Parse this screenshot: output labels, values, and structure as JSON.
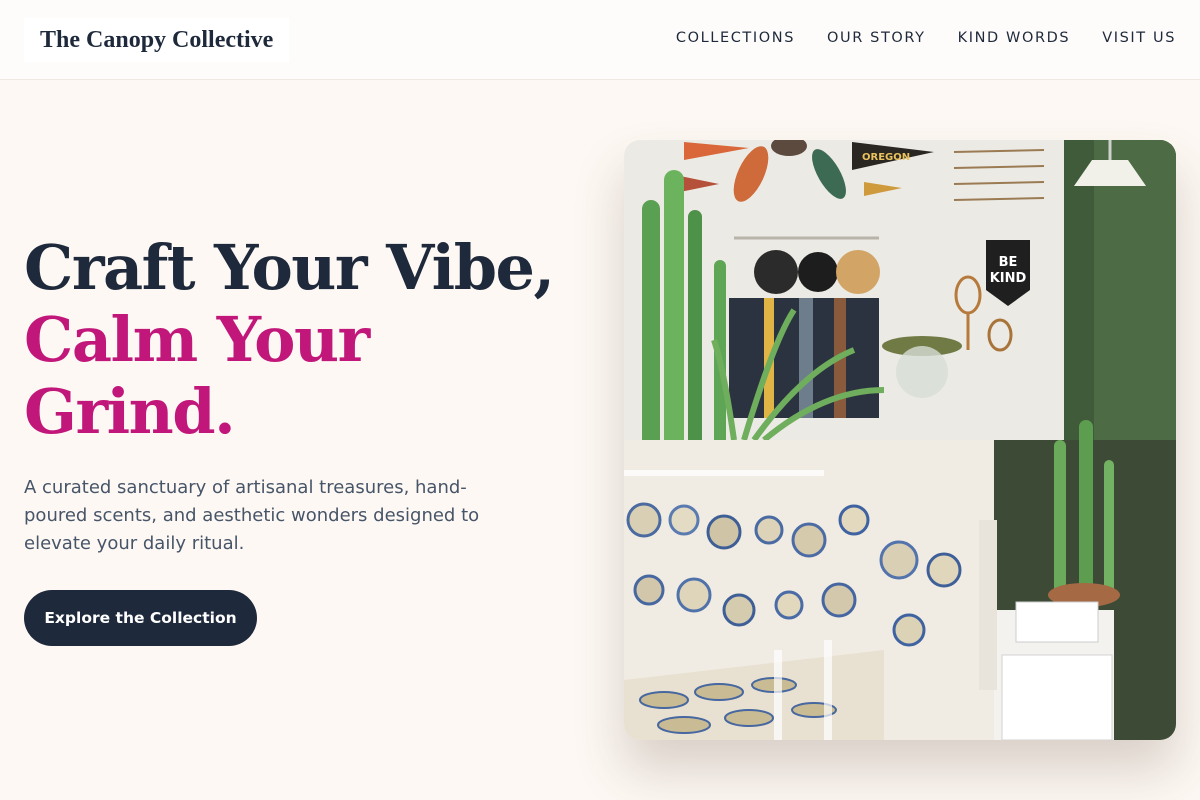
{
  "brand": {
    "name": "The Canopy Collective"
  },
  "nav": {
    "items": [
      {
        "label": "COLLECTIONS"
      },
      {
        "label": "OUR STORY"
      },
      {
        "label": "KIND WORDS"
      },
      {
        "label": "VISIT US"
      }
    ]
  },
  "hero": {
    "headline_line1": "Craft Your Vibe,",
    "headline_line2": "Calm Your",
    "headline_line3": "Grind.",
    "subtext": "A curated sanctuary of artisanal treasures, hand-poured scents, and aesthetic wonders designed to elevate your daily ritual.",
    "cta_label": "Explore the Collection"
  },
  "image": {
    "banner_text_line1": "BE",
    "banner_text_line2": "KIND",
    "pennant_text": "OREGON"
  },
  "colors": {
    "background": "#fdf8f3",
    "navy": "#1e293b",
    "accent_pink": "#c2177a",
    "body_text": "#475569"
  }
}
